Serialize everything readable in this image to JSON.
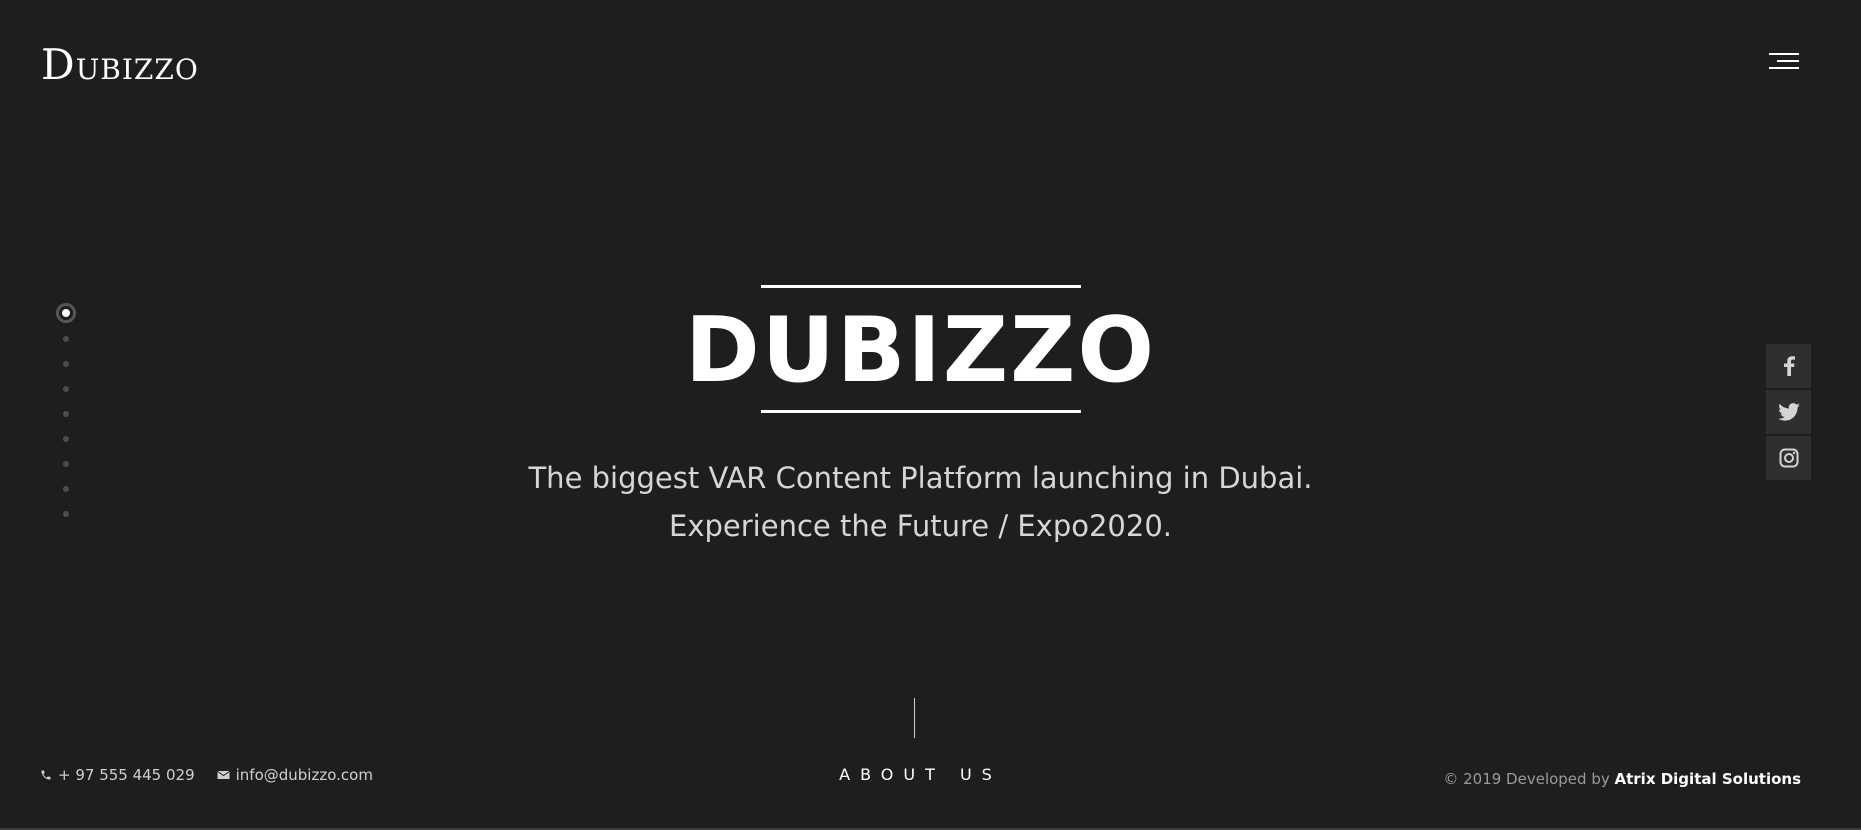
{
  "header": {
    "logo_first": "D",
    "logo_rest": "UBIZZO",
    "menu_icon": "hamburger-menu-icon"
  },
  "slider": {
    "total_slides": 9,
    "active_index": 0
  },
  "hero": {
    "title": "DUBIZZO",
    "subtitle_line1": "The biggest VAR Content Platform launching in Dubai.",
    "subtitle_line2": "Experience the Future / Expo2020."
  },
  "social": [
    {
      "name": "facebook",
      "icon": "facebook-icon"
    },
    {
      "name": "twitter",
      "icon": "twitter-icon"
    },
    {
      "name": "instagram",
      "icon": "instagram-icon"
    }
  ],
  "scroll": {
    "label": "ABOUT US"
  },
  "footer": {
    "phone": "+ 97 555 445 029",
    "phone_icon": "phone-icon",
    "email": "info@dubizzo.com",
    "email_icon": "mail-icon",
    "credits_prefix": "© 2019 Developed by ",
    "credits_company": "Atrix Digital Solutions"
  },
  "colors": {
    "background": "#1e1e1e",
    "text": "#ffffff",
    "muted_text": "#d6d6d6",
    "social_bg": "#2f2f2f",
    "inactive_dot": "#4c4c4c"
  }
}
